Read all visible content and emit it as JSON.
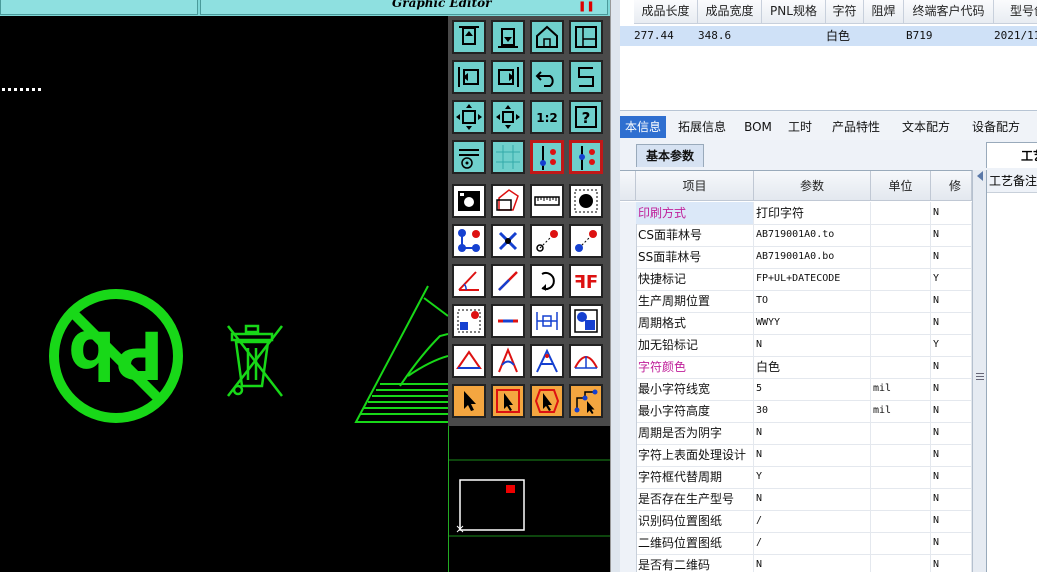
{
  "graphic_editor": {
    "title": "Graphic Editor"
  },
  "product_table": {
    "headers": [
      "成品长度",
      "成品宽度",
      "PNL规格",
      "字符",
      "阻焊",
      "终端客户代码",
      "型号创"
    ],
    "row": [
      "277.44",
      "348.6",
      "",
      "白色",
      "",
      "B719",
      "2021/11/"
    ]
  },
  "tabs": [
    "本信息",
    "拓展信息",
    "BOM",
    "工时",
    "产品特性",
    "文本配方",
    "设备配方"
  ],
  "active_tab": "本信息",
  "subtab": "基本参数",
  "right_subtab": "工艺",
  "remark_header": "工艺备注",
  "param_grid": {
    "headers": [
      "项目",
      "参数",
      "单位",
      "修"
    ],
    "rows": [
      {
        "item": "印刷方式",
        "value": "打印字符",
        "unit": "",
        "flag": "N",
        "magenta": true,
        "selected": true
      },
      {
        "item": "CS面菲林号",
        "value": "AB719001A0.to",
        "unit": "",
        "flag": "N",
        "magenta": false
      },
      {
        "item": "SS面菲林号",
        "value": "AB719001A0.bo",
        "unit": "",
        "flag": "N",
        "magenta": false
      },
      {
        "item": "快捷标记",
        "value": "FP+UL+DATECODE",
        "unit": "",
        "flag": "Y",
        "magenta": false
      },
      {
        "item": "生产周期位置",
        "value": "TO",
        "unit": "",
        "flag": "N",
        "magenta": false
      },
      {
        "item": "周期格式",
        "value": "WWYY",
        "unit": "",
        "flag": "N",
        "magenta": false
      },
      {
        "item": "加无铅标记",
        "value": "N",
        "unit": "",
        "flag": "Y",
        "magenta": false
      },
      {
        "item": "字符颜色",
        "value": "白色",
        "unit": "",
        "flag": "N",
        "magenta": true
      },
      {
        "item": "最小字符线宽",
        "value": "5",
        "unit": "mil",
        "flag": "N",
        "magenta": false
      },
      {
        "item": "最小字符高度",
        "value": "30",
        "unit": "mil",
        "flag": "N",
        "magenta": false
      },
      {
        "item": "周期是否为阴字",
        "value": "N",
        "unit": "",
        "flag": "N",
        "magenta": false
      },
      {
        "item": "字符上表面处理设计",
        "value": "N",
        "unit": "",
        "flag": "N",
        "magenta": false
      },
      {
        "item": "字符框代替周期",
        "value": "Y",
        "unit": "",
        "flag": "N",
        "magenta": false
      },
      {
        "item": "是否存在生产型号",
        "value": "N",
        "unit": "",
        "flag": "N",
        "magenta": false
      },
      {
        "item": "识别码位置图纸",
        "value": "/",
        "unit": "",
        "flag": "N",
        "magenta": false
      },
      {
        "item": "二维码位置图纸",
        "value": "/",
        "unit": "",
        "flag": "N",
        "magenta": false
      },
      {
        "item": "是否有二维码",
        "value": "N",
        "unit": "",
        "flag": "N",
        "magenta": false
      }
    ]
  },
  "toolbar_icons": [
    "align-top-icon",
    "align-bottom-icon",
    "home-icon",
    "grid-frame-icon",
    "align-left-icon",
    "align-right-icon",
    "undo-icon",
    "redo-icon",
    "fit-screen-icon",
    "center-view-icon",
    "scale-1-2-icon",
    "help-icon",
    "settings-icon",
    "grid-icon",
    "snap-icon",
    "snap-alt-icon",
    "camera-icon",
    "polygon-icon",
    "ruler-icon",
    "fill-circle-icon",
    "nodes-icon",
    "cross-icon",
    "line-point-icon",
    "line-point-alt-icon",
    "angle-icon",
    "slash-icon",
    "rotate-icon",
    "mirror-text-icon",
    "corner-icon",
    "minus-icon",
    "dimension-icon",
    "shapes-icon",
    "arc-triangle-icon",
    "arc-a-icon",
    "arc-b-icon",
    "arc-c-icon",
    "pointer-icon",
    "pointer-box-icon",
    "pointer-hex-icon",
    "pointer-node-icon"
  ],
  "colors": {
    "canvas_green": "#18d818",
    "teal": "#6fd0cc",
    "accent_blue": "#2f6fd0"
  }
}
